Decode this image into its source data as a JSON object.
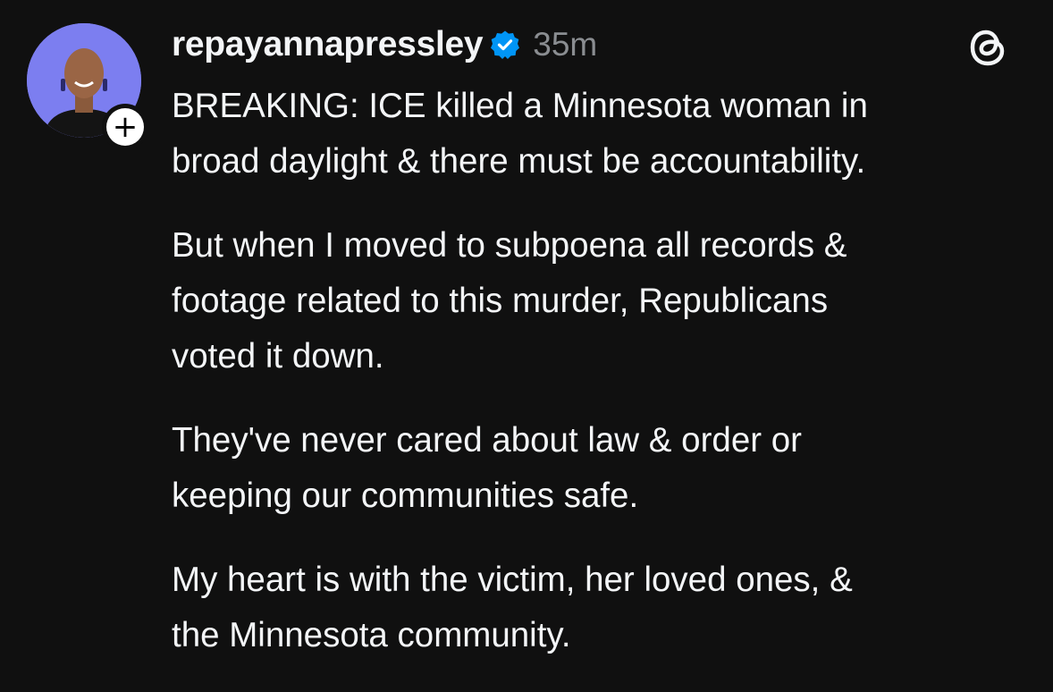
{
  "post": {
    "username": "repayannapressley",
    "timestamp": "35m",
    "verified": true,
    "follow_symbol": "+",
    "paragraphs": [
      "BREAKING: ICE killed a Minnesota woman in\nbroad daylight & there must be accountability.",
      "But when I moved to subpoena all records &\nfootage related to this murder, Republicans\nvoted it down.",
      "They've never cared about law & order or\nkeeping our communities safe.",
      "My heart is with the victim, her loved ones, &\nthe Minnesota community."
    ]
  },
  "icons": {
    "verified": "verified-badge-icon",
    "threads": "threads-logo-icon",
    "follow": "plus-icon"
  },
  "colors": {
    "background": "#101010",
    "text": "#f3f5f7",
    "muted": "#8a8d91",
    "verified_blue": "#0095f6",
    "avatar_bg": "#7c7ef0"
  }
}
